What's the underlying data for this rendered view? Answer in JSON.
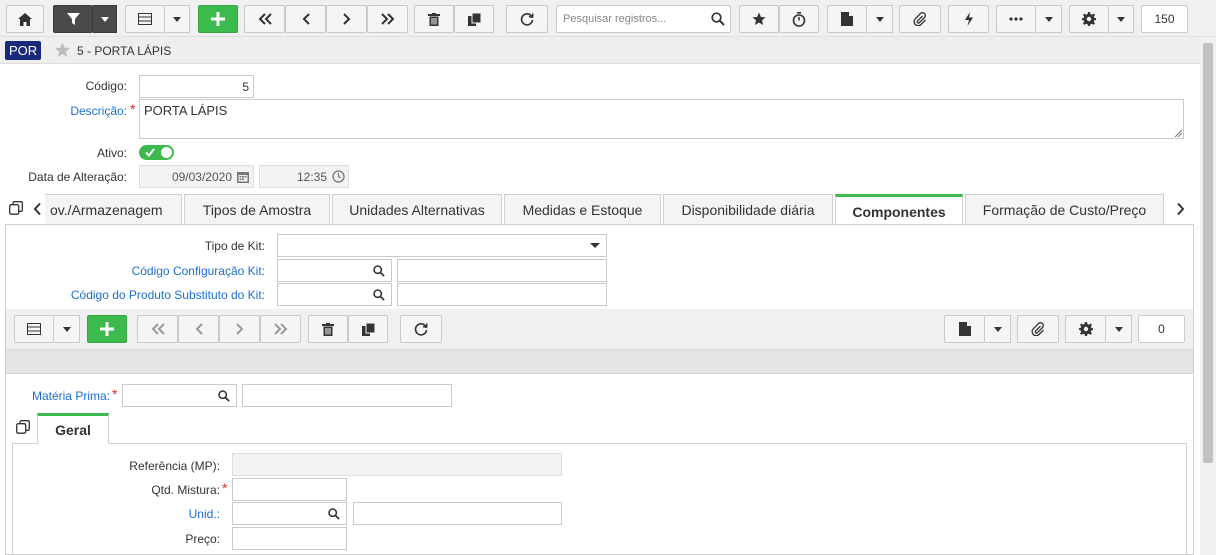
{
  "toolbar": {
    "search_placeholder": "Pesquisar registros...",
    "record_count": "150"
  },
  "header": {
    "badge": "POR",
    "title": "5 - PORTA LÁPIS"
  },
  "form": {
    "codigo_label": "Código:",
    "codigo_value": "5",
    "descricao_label": "Descrição:",
    "descricao_value": "PORTA LÁPIS",
    "ativo_label": "Ativo:",
    "data_alteracao_label": "Data de Alteração:",
    "data_value": "09/03/2020",
    "hora_value": "12:35"
  },
  "tabs": [
    {
      "label": "ov./Armazenagem"
    },
    {
      "label": "Tipos de Amostra"
    },
    {
      "label": "Unidades Alternativas"
    },
    {
      "label": "Medidas e Estoque"
    },
    {
      "label": "Disponibilidade diária"
    },
    {
      "label": "Componentes",
      "active": true
    },
    {
      "label": "Formação de Custo/Preço"
    }
  ],
  "componentes": {
    "tipo_kit_label": "Tipo de Kit:",
    "codigo_config_label": "Código Configuração Kit:",
    "codigo_substituto_label": "Código do Produto Substituto do Kit:",
    "grid_count": "0",
    "materia_prima_label": "Matéria Prima:",
    "inner_tab": "Geral",
    "referencia_label": "Referência (MP):",
    "qtd_mistura_label": "Qtd. Mistura:",
    "unid_label": "Unid.:",
    "preco_label": "Preço:"
  },
  "colors": {
    "accent": "#3dba4e",
    "badge": "#1b2a78",
    "link": "#1a6fd0",
    "required": "#d9262c"
  }
}
